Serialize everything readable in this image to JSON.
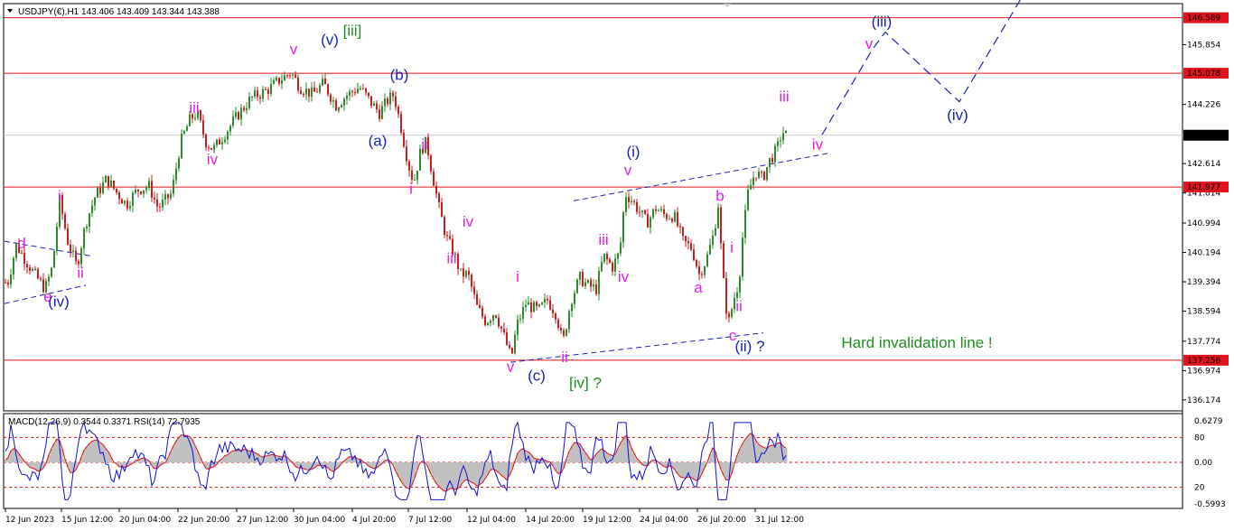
{
  "header": {
    "symbol_info": "USDJPY(€),H1  143.406 143.409 143.344 143.388",
    "macd_info": "MACD(12,26,9) 0.3544 0.3371  RSI(14) 72.7935"
  },
  "colors": {
    "background": "#ffffff",
    "bull_candle": "#2e8b2e",
    "bear_candle": "#c81e1e",
    "level_line": "#e0141c",
    "level_tag_fill": "#e0141c",
    "current_price_tag_fill": "#000000",
    "wave_blue": "#1a22b8",
    "wave_magenta": "#e61ee6",
    "wave_green": "#1e8c1e",
    "macd_hist": "#c0c0c0",
    "macd_signal": "#e01010",
    "rsi_line": "#1010d8"
  },
  "chart_data": {
    "type": "candlestick",
    "y_axis_ticks": [
      "145.854",
      "144.226",
      "142.614",
      "141.814",
      "140.994",
      "140.194",
      "139.394",
      "138.594",
      "137.774",
      "136.974",
      "136.174"
    ],
    "y_range": [
      135.9,
      146.95
    ],
    "x_axis_ticks": [
      "12 Jun 2023",
      "15 Jun 12:00",
      "20 Jun 04:00",
      "22 Jun 20:00",
      "27 Jun 12:00",
      "30 Jun 04:00",
      "4 Jul 20:00",
      "7 Jul 12:00",
      "12 Jul 04:00",
      "14 Jul 20:00",
      "19 Jul 12:00",
      "24 Jul 04:00",
      "26 Jul 20:00",
      "31 Jul 12:00"
    ],
    "horizontal_levels": [
      {
        "price": 146.589,
        "label": "146.589"
      },
      {
        "price": 145.078,
        "label": "145.078"
      },
      {
        "price": 141.977,
        "label": "141.977"
      },
      {
        "price": 137.256,
        "label": "137.256"
      }
    ],
    "current_price": {
      "price": 143.388,
      "label": "143.388"
    },
    "price_path": [
      [
        0,
        139.6
      ],
      [
        8,
        139.3
      ],
      [
        18,
        140.4
      ],
      [
        28,
        140.0
      ],
      [
        38,
        139.6
      ],
      [
        50,
        139.2
      ],
      [
        58,
        139.8
      ],
      [
        66,
        141.6
      ],
      [
        75,
        140.5
      ],
      [
        85,
        139.8
      ],
      [
        95,
        141.0
      ],
      [
        105,
        141.7
      ],
      [
        118,
        142.2
      ],
      [
        130,
        141.8
      ],
      [
        140,
        141.5
      ],
      [
        152,
        141.9
      ],
      [
        165,
        142.0
      ],
      [
        175,
        141.4
      ],
      [
        190,
        141.8
      ],
      [
        200,
        143.2
      ],
      [
        210,
        143.8
      ],
      [
        218,
        144.0
      ],
      [
        228,
        143.2
      ],
      [
        236,
        143.0
      ],
      [
        248,
        143.4
      ],
      [
        262,
        143.9
      ],
      [
        278,
        144.4
      ],
      [
        295,
        144.6
      ],
      [
        310,
        144.9
      ],
      [
        322,
        145.1
      ],
      [
        332,
        144.7
      ],
      [
        346,
        144.5
      ],
      [
        358,
        144.8
      ],
      [
        372,
        144.2
      ],
      [
        385,
        144.5
      ],
      [
        398,
        144.7
      ],
      [
        410,
        144.3
      ],
      [
        420,
        144.0
      ],
      [
        428,
        144.3
      ],
      [
        436,
        144.5
      ],
      [
        444,
        143.6
      ],
      [
        452,
        142.6
      ],
      [
        458,
        142.1
      ],
      [
        466,
        143.0
      ],
      [
        472,
        143.2
      ],
      [
        478,
        142.4
      ],
      [
        486,
        141.4
      ],
      [
        494,
        140.6
      ],
      [
        502,
        140.2
      ],
      [
        510,
        139.6
      ],
      [
        518,
        139.6
      ],
      [
        528,
        138.7
      ],
      [
        538,
        138.3
      ],
      [
        548,
        138.6
      ],
      [
        558,
        137.9
      ],
      [
        566,
        137.3
      ],
      [
        572,
        138.2
      ],
      [
        582,
        138.8
      ],
      [
        596,
        138.6
      ],
      [
        606,
        138.9
      ],
      [
        616,
        138.5
      ],
      [
        623,
        137.7
      ],
      [
        632,
        138.9
      ],
      [
        642,
        139.5
      ],
      [
        650,
        139.3
      ],
      [
        660,
        139.2
      ],
      [
        668,
        140.1
      ],
      [
        678,
        139.8
      ],
      [
        686,
        140.2
      ],
      [
        692,
        141.8
      ],
      [
        700,
        141.6
      ],
      [
        708,
        141.3
      ],
      [
        716,
        141.0
      ],
      [
        726,
        141.4
      ],
      [
        736,
        141.2
      ],
      [
        746,
        141.2
      ],
      [
        756,
        140.5
      ],
      [
        766,
        140.3
      ],
      [
        774,
        139.6
      ],
      [
        782,
        140.0
      ],
      [
        790,
        140.7
      ],
      [
        795,
        141.5
      ],
      [
        800,
        139.6
      ],
      [
        806,
        138.2
      ],
      [
        812,
        138.9
      ],
      [
        818,
        139.4
      ],
      [
        822,
        140.6
      ],
      [
        828,
        141.8
      ],
      [
        836,
        142.4
      ],
      [
        844,
        142.2
      ],
      [
        852,
        142.7
      ],
      [
        860,
        143.0
      ],
      [
        866,
        143.5
      ],
      [
        870,
        143.388
      ]
    ],
    "channel_lines": [
      {
        "from": [
          5,
          140.5
        ],
        "to": [
          100,
          140.1
        ]
      },
      {
        "from": [
          5,
          138.8
        ],
        "to": [
          95,
          139.3
        ]
      },
      {
        "from": [
          565,
          137.2
        ],
        "to": [
          845,
          138.0
        ]
      },
      {
        "from": [
          635,
          141.6
        ],
        "to": [
          918,
          142.9
        ]
      }
    ],
    "projection_path": [
      [
        910,
        143.4
      ],
      [
        965,
        145.7
      ],
      [
        980,
        146.2
      ],
      [
        1062,
        144.3
      ],
      [
        1130,
        147.1
      ]
    ],
    "wave_labels": [
      {
        "text": "d",
        "x": 24,
        "price": 140.3,
        "color": "magenta"
      },
      {
        "text": "e",
        "x": 53,
        "price": 138.85,
        "color": "magenta"
      },
      {
        "text": "(iv)",
        "x": 65,
        "price": 138.72,
        "color": "blue"
      },
      {
        "text": "i",
        "x": 66,
        "price": 141.6,
        "color": "magenta"
      },
      {
        "text": "ii",
        "x": 89,
        "price": 139.5,
        "color": "magenta"
      },
      {
        "text": "iii",
        "x": 215,
        "price": 144.0,
        "color": "magenta"
      },
      {
        "text": "iv",
        "x": 235,
        "price": 142.6,
        "color": "magenta"
      },
      {
        "text": "v",
        "x": 325,
        "price": 145.6,
        "color": "magenta"
      },
      {
        "text": "(v)",
        "x": 365,
        "price": 145.85,
        "color": "blue"
      },
      {
        "text": "[iii]",
        "x": 390,
        "price": 146.1,
        "color": "green"
      },
      {
        "text": "(b)",
        "x": 442,
        "price": 144.9,
        "color": "blue"
      },
      {
        "text": "(a)",
        "x": 418,
        "price": 143.1,
        "color": "blue"
      },
      {
        "text": "ii",
        "x": 470,
        "price": 143.0,
        "color": "magenta"
      },
      {
        "text": "i",
        "x": 455,
        "price": 141.8,
        "color": "magenta"
      },
      {
        "text": "iv",
        "x": 518,
        "price": 140.9,
        "color": "magenta"
      },
      {
        "text": "iii",
        "x": 500,
        "price": 139.9,
        "color": "magenta"
      },
      {
        "text": "i",
        "x": 573,
        "price": 139.4,
        "color": "magenta"
      },
      {
        "text": "v",
        "x": 565,
        "price": 136.95,
        "color": "magenta"
      },
      {
        "text": "ii",
        "x": 625,
        "price": 137.2,
        "color": "magenta"
      },
      {
        "text": "(c)",
        "x": 594,
        "price": 136.7,
        "color": "blue"
      },
      {
        "text": "[iv] ?",
        "x": 648,
        "price": 136.5,
        "color": "green"
      },
      {
        "text": "(i)",
        "x": 701,
        "price": 142.8,
        "color": "blue"
      },
      {
        "text": "v",
        "x": 695,
        "price": 142.3,
        "color": "magenta"
      },
      {
        "text": "iii",
        "x": 668,
        "price": 140.4,
        "color": "magenta"
      },
      {
        "text": "iv",
        "x": 690,
        "price": 139.4,
        "color": "magenta"
      },
      {
        "text": "b",
        "x": 797,
        "price": 141.6,
        "color": "magenta"
      },
      {
        "text": "a",
        "x": 773,
        "price": 139.1,
        "color": "magenta"
      },
      {
        "text": "i",
        "x": 810,
        "price": 140.2,
        "color": "magenta"
      },
      {
        "text": "ii",
        "x": 818,
        "price": 138.6,
        "color": "magenta"
      },
      {
        "text": "c",
        "x": 811,
        "price": 137.8,
        "color": "magenta"
      },
      {
        "text": "(ii) ?",
        "x": 830,
        "price": 137.5,
        "color": "blue"
      },
      {
        "text": "iii",
        "x": 868,
        "price": 144.3,
        "color": "magenta"
      },
      {
        "text": "iv",
        "x": 905,
        "price": 143.0,
        "color": "magenta"
      },
      {
        "text": "v",
        "x": 962,
        "price": 145.75,
        "color": "magenta"
      },
      {
        "text": "(iii)",
        "x": 976,
        "price": 146.35,
        "color": "blue"
      },
      {
        "text": "(iv)",
        "x": 1060,
        "price": 143.8,
        "color": "blue"
      }
    ],
    "annotation": {
      "text": "Hard invalidation line !",
      "x": 1015,
      "price": 137.6,
      "color": "green"
    },
    "indicator": {
      "y_axis_ticks": [
        "0.6279",
        "80",
        "0.00",
        "20",
        "-0.5993"
      ],
      "levels": [
        80,
        20
      ],
      "range": [
        -0.5993,
        0.6279
      ]
    }
  }
}
